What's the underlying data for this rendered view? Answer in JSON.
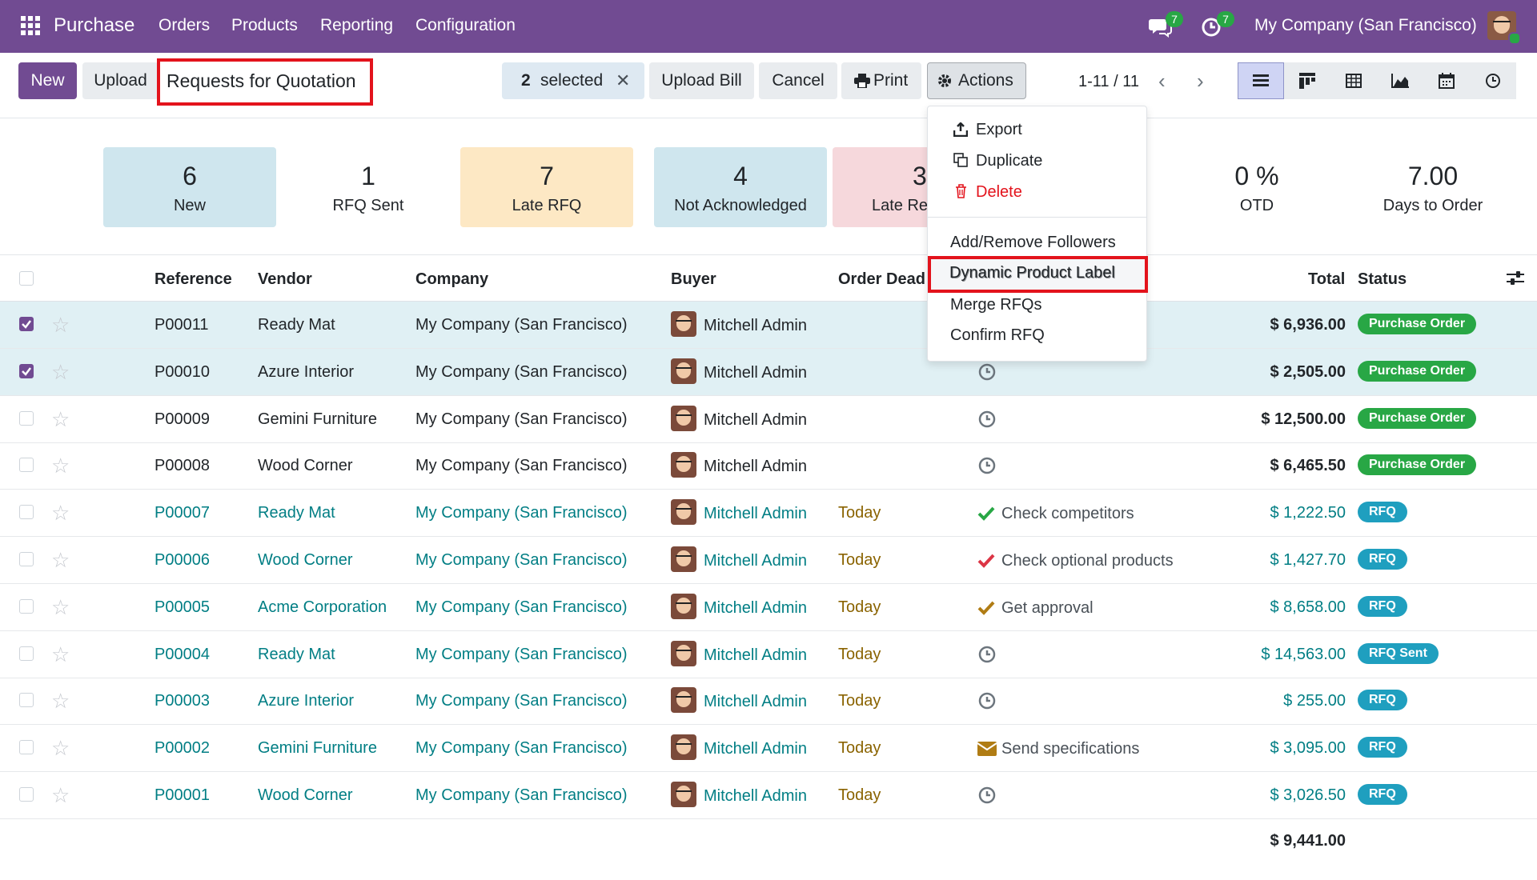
{
  "navbar": {
    "app_name": "Purchase",
    "menus": [
      "Orders",
      "Products",
      "Reporting",
      "Configuration"
    ],
    "messages_count": "7",
    "activities_count": "7",
    "company": "My Company (San Francisco)"
  },
  "control": {
    "new_label": "New",
    "upload_label": "Upload",
    "breadcrumb": "Requests for Quotation",
    "selected_count": "2",
    "selected_label": "selected",
    "upload_bill_label": "Upload Bill",
    "cancel_label": "Cancel",
    "print_label": "Print",
    "actions_label": "Actions",
    "pager": "1-11 / 11"
  },
  "actions_menu": {
    "export": "Export",
    "duplicate": "Duplicate",
    "delete": "Delete",
    "followers": "Add/Remove Followers",
    "dynamic_label": "Dynamic Product Label",
    "merge": "Merge RFQs",
    "confirm": "Confirm RFQ"
  },
  "kpis": {
    "new": {
      "value": "6",
      "label": "New"
    },
    "rfq_sent": {
      "value": "1",
      "label": "RFQ Sent"
    },
    "late_rfq": {
      "value": "7",
      "label": "Late RFQ"
    },
    "not_ack": {
      "value": "4",
      "label": "Not Acknowledged"
    },
    "late_receipt": {
      "value": "3",
      "label": "Late Re"
    },
    "otd": {
      "value": "0 %",
      "label": "OTD"
    },
    "days": {
      "value": "7.00",
      "label": "Days to Order"
    }
  },
  "table": {
    "headers": {
      "reference": "Reference",
      "vendor": "Vendor",
      "company": "Company",
      "buyer": "Buyer",
      "deadline": "Order Dead",
      "total": "Total",
      "status": "Status"
    },
    "rows": [
      {
        "ref": "P00011",
        "vendor": "Ready Mat",
        "company": "My Company (San Francisco)",
        "buyer": "Mitchell Admin",
        "deadline": "",
        "activity": "",
        "total": "$ 6,936.00",
        "status": "Purchase Order"
      },
      {
        "ref": "P00010",
        "vendor": "Azure Interior",
        "company": "My Company (San Francisco)",
        "buyer": "Mitchell Admin",
        "deadline": "",
        "activity": "",
        "total": "$ 2,505.00",
        "status": "Purchase Order"
      },
      {
        "ref": "P00009",
        "vendor": "Gemini Furniture",
        "company": "My Company (San Francisco)",
        "buyer": "Mitchell Admin",
        "deadline": "",
        "activity": "",
        "total": "$ 12,500.00",
        "status": "Purchase Order"
      },
      {
        "ref": "P00008",
        "vendor": "Wood Corner",
        "company": "My Company (San Francisco)",
        "buyer": "Mitchell Admin",
        "deadline": "",
        "activity": "",
        "total": "$ 6,465.50",
        "status": "Purchase Order"
      },
      {
        "ref": "P00007",
        "vendor": "Ready Mat",
        "company": "My Company (San Francisco)",
        "buyer": "Mitchell Admin",
        "deadline": "Today",
        "activity": "Check competitors",
        "total": "$ 1,222.50",
        "status": "RFQ"
      },
      {
        "ref": "P00006",
        "vendor": "Wood Corner",
        "company": "My Company (San Francisco)",
        "buyer": "Mitchell Admin",
        "deadline": "Today",
        "activity": "Check optional products",
        "total": "$ 1,427.70",
        "status": "RFQ"
      },
      {
        "ref": "P00005",
        "vendor": "Acme Corporation",
        "company": "My Company (San Francisco)",
        "buyer": "Mitchell Admin",
        "deadline": "Today",
        "activity": "Get approval",
        "total": "$ 8,658.00",
        "status": "RFQ"
      },
      {
        "ref": "P00004",
        "vendor": "Ready Mat",
        "company": "My Company (San Francisco)",
        "buyer": "Mitchell Admin",
        "deadline": "Today",
        "activity": "",
        "total": "$ 14,563.00",
        "status": "RFQ Sent"
      },
      {
        "ref": "P00003",
        "vendor": "Azure Interior",
        "company": "My Company (San Francisco)",
        "buyer": "Mitchell Admin",
        "deadline": "Today",
        "activity": "",
        "total": "$ 255.00",
        "status": "RFQ"
      },
      {
        "ref": "P00002",
        "vendor": "Gemini Furniture",
        "company": "My Company (San Francisco)",
        "buyer": "Mitchell Admin",
        "deadline": "Today",
        "activity": "Send specifications",
        "total": "$ 3,095.00",
        "status": "RFQ"
      },
      {
        "ref": "P00001",
        "vendor": "Wood Corner",
        "company": "My Company (San Francisco)",
        "buyer": "Mitchell Admin",
        "deadline": "Today",
        "activity": "",
        "total": "$ 3,026.50",
        "status": "RFQ"
      }
    ],
    "grand_total": "$ 9,441.00"
  },
  "colors": {
    "brand": "#714b92",
    "link": "#017e84",
    "highlight": "#e3131c",
    "success": "#28a745",
    "info": "#1f9fbf"
  }
}
